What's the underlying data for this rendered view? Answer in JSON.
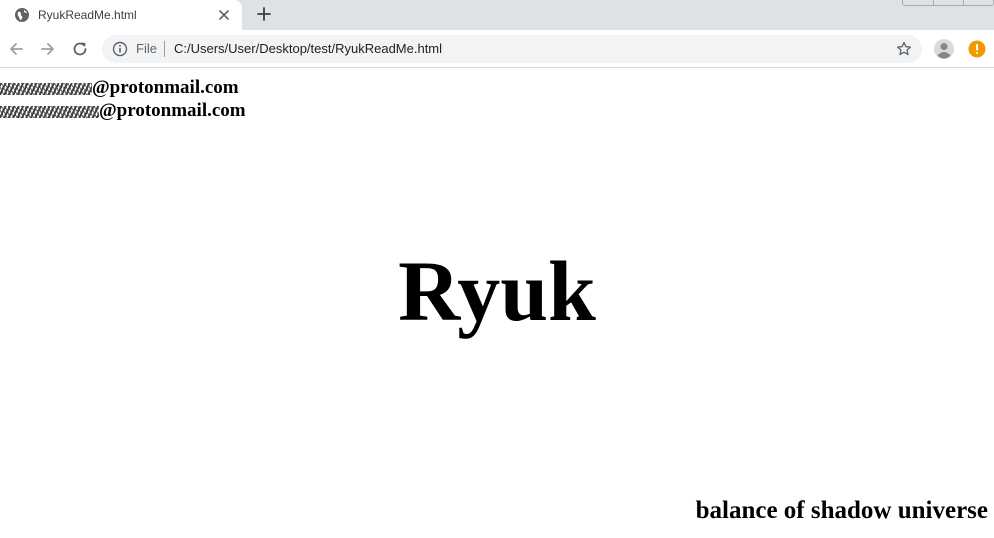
{
  "browser": {
    "tab": {
      "title": "RyukReadMe.html",
      "favicon": "globe-icon",
      "close_icon": "close-icon"
    },
    "new_tab_icon": "plus-icon",
    "toolbar": {
      "back_icon": "arrow-left-icon",
      "forward_icon": "arrow-right-icon",
      "reload_icon": "reload-icon",
      "site_info_icon": "info-icon",
      "scheme_label": "File",
      "url": "C:/Users/User/Desktop/test/RyukReadMe.html",
      "bookmark_icon": "star-icon",
      "profile_icon": "avatar-icon",
      "alert_icon": "alert-icon"
    },
    "colors": {
      "tabstrip": "#dee1e6",
      "omnibox": "#f1f3f4",
      "alert": "#f29900"
    }
  },
  "page": {
    "emails": [
      {
        "domain": "@protonmail.com"
      },
      {
        "domain": "@protonmail.com"
      }
    ],
    "title": "Ryuk",
    "footer": "balance of shadow universe"
  }
}
